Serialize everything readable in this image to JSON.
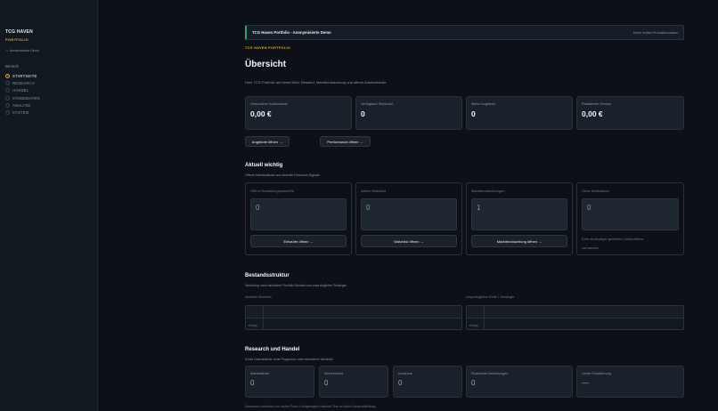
{
  "sidebar": {
    "brand_title": "TCG HAVEN",
    "brand_sub": "PORTFOLIO",
    "user": "Anonymisierte Demo",
    "section_label": "Bereich",
    "items": [
      {
        "label": "STARTSEITE",
        "active": true
      },
      {
        "label": "RESEARCH",
        "active": false
      },
      {
        "label": "HANDEL",
        "active": false
      },
      {
        "label": "STAMMDATEN",
        "active": false
      },
      {
        "label": "ANALYSE",
        "active": false
      },
      {
        "label": "SYSTEM",
        "active": false
      }
    ]
  },
  "banner": {
    "title": "TCG Haven Portfolio - Anonymisierte Demo",
    "right": "Keine echten Produktionsdaten"
  },
  "header": {
    "kicker": "TCG HAVEN PORTFOLIO",
    "title": "Übersicht",
    "intro": "Dein TCG-Portfolio auf einen Blick: Bestand, Marktbeobachtung und offene Arbeitsstände."
  },
  "kpis": [
    {
      "label": "Gebundene Kostenbasis",
      "value": "0,00 €"
    },
    {
      "label": "Verfügbare Stückzahl",
      "value": "0"
    },
    {
      "label": "Aktive Angebote",
      "value": "0"
    },
    {
      "label": "Realisierter Gewinn",
      "value": "0,00 €"
    }
  ],
  "actions": {
    "offers": "Angebote öffnen →",
    "performance": "Performance öffnen →"
  },
  "current": {
    "title": "Aktuell wichtig",
    "sub": "Offene Arbeitsstände und zentrale Research-Signale",
    "panels": [
      {
        "label": "Offene Bestellungsentwürfe",
        "value": "0",
        "button": "Entwürfe öffnen →"
      },
      {
        "label": "Aktive Watchlist",
        "value": "0",
        "button": "Watchlist öffnen →"
      },
      {
        "label": "Marktbeobachtungen",
        "value": "1",
        "button": "Marktbeobachtung öffnen →"
      },
      {
        "label": "Ohne Marktdaten",
        "value": "0",
        "note_line1": "Kein eindeutiger geführter Zielworkflow",
        "note_line2": "vorhanden."
      }
    ]
  },
  "structure": {
    "title": "Bestandsstruktur",
    "sub": "Verteilung nach aktuellem Portfolio-Bucket und ursprünglicher Strategie.",
    "left_label": "Aktuelle Buckets",
    "right_label": "Ursprüngliche Rolle / Strategie",
    "empty": "empty"
  },
  "research": {
    "title": "Research und Handel",
    "sub": "Echte Datenstände ohne Prognosen oder erfundene Wertzahl.",
    "cards": [
      {
        "label": "Marktstände",
        "value": "0"
      },
      {
        "label": "Screenshots",
        "value": "0"
      },
      {
        "label": "Kaufzone",
        "value": "0"
      },
      {
        "label": "Finalisierte Bestellungen",
        "value": "0"
      },
      {
        "label": "Letzte Finalisierung",
        "value": "—"
      }
    ],
    "footnote": "Kaufzonen bedeuten nur letzter Floor ≤ festgelegten Kaufziel. Das ist keine Kaufempfehlung."
  },
  "colors": {
    "accent": "#e3a33a",
    "success": "#2fa46a",
    "background": "#0d1117"
  }
}
